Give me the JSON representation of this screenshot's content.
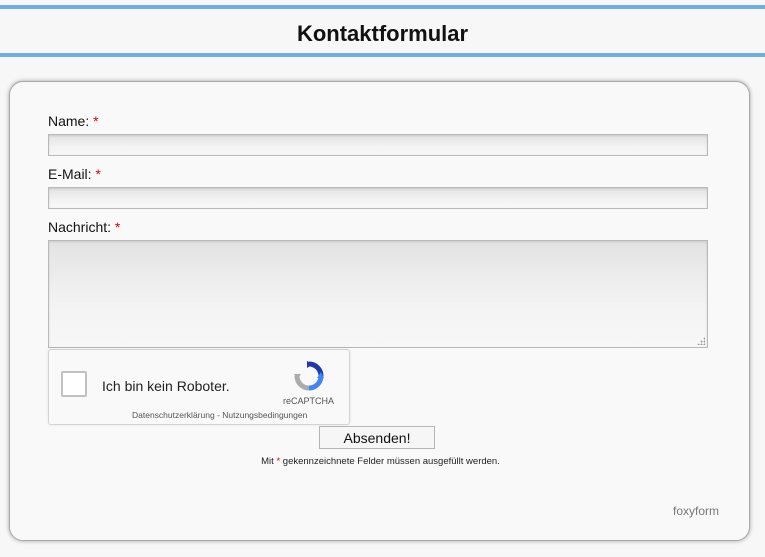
{
  "header": {
    "title": "Kontaktformular"
  },
  "form": {
    "name_label": "Name:",
    "email_label": "E-Mail:",
    "message_label": "Nachricht:",
    "required_mark": "*",
    "name_value": "",
    "email_value": "",
    "message_value": ""
  },
  "captcha": {
    "label": "Ich bin kein Roboter.",
    "brand": "reCAPTCHA",
    "privacy_link": "Datenschutzerklärung",
    "separator": " - ",
    "terms_link": "Nutzungsbedingungen",
    "checked": false
  },
  "submit": {
    "label": "Absenden!"
  },
  "note": {
    "prefix": "Mit ",
    "mark": "*",
    "suffix": " gekennzeichnete Felder müssen ausgefüllt werden."
  },
  "footer": {
    "brand": "foxyform"
  },
  "colors": {
    "accent": "#6faee3",
    "required": "#dd0000"
  }
}
